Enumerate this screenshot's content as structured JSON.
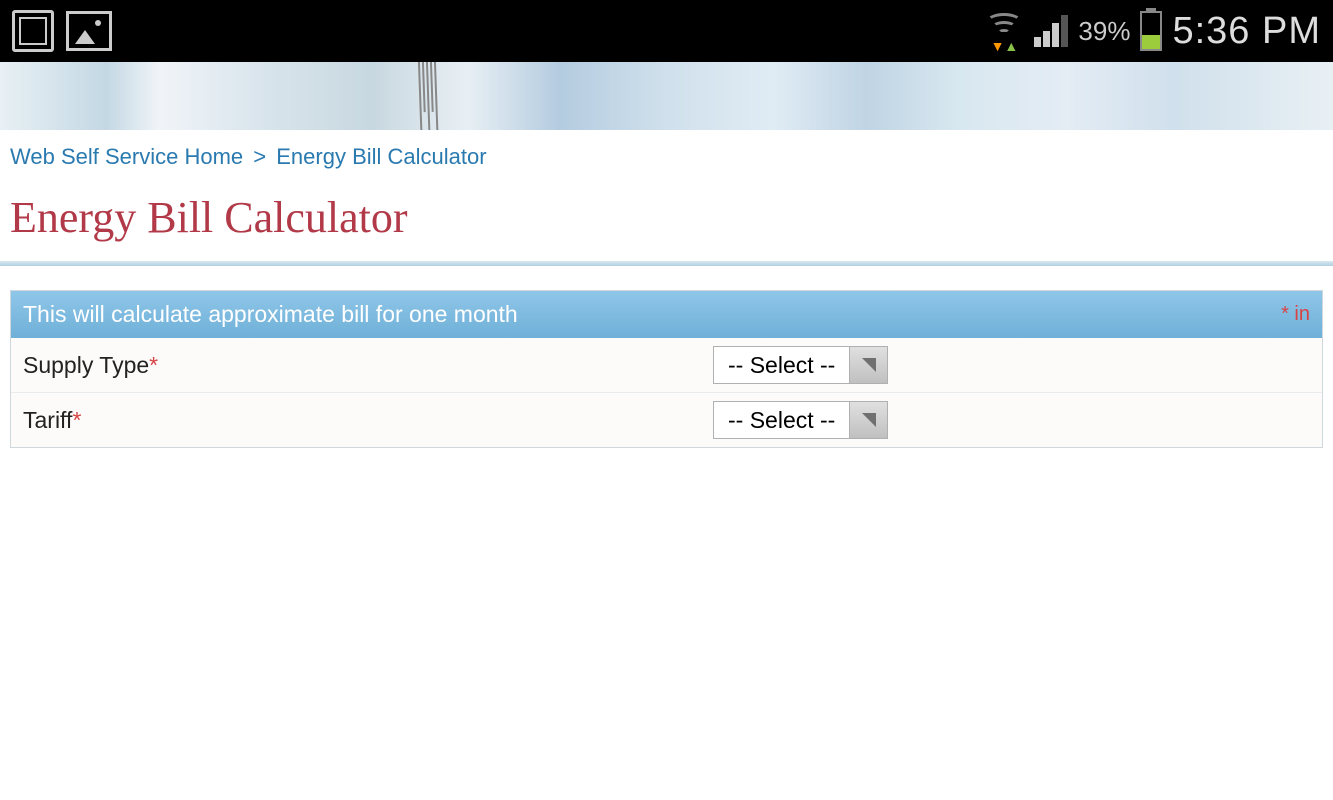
{
  "status_bar": {
    "battery_percent": "39%",
    "clock": "5:36 PM"
  },
  "breadcrumb": {
    "home": "Web Self Service Home",
    "separator": ">",
    "current": "Energy Bill Calculator"
  },
  "page_title": "Energy Bill Calculator",
  "panel": {
    "header_text": "This will calculate approximate bill for one month",
    "header_right": "* in"
  },
  "form": {
    "rows": [
      {
        "label": "Supply Type",
        "selected": "-- Select --"
      },
      {
        "label": "Tariff",
        "selected": "-- Select --"
      }
    ]
  }
}
